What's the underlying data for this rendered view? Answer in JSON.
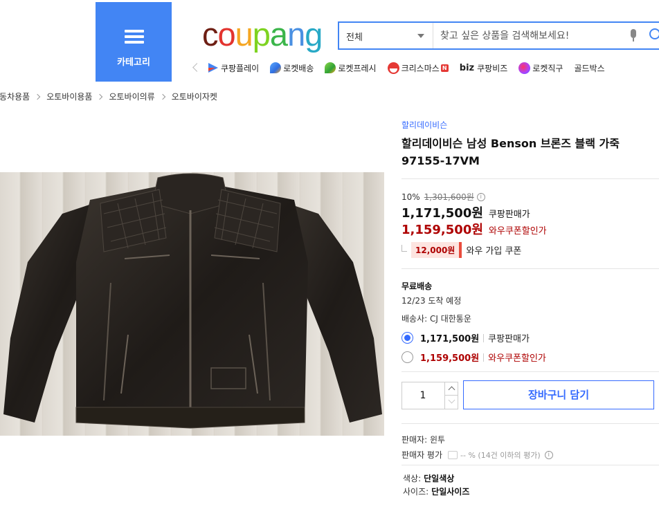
{
  "header": {
    "category_label": "카테고리",
    "logo_text": "coupang",
    "search": {
      "scope": "전체",
      "placeholder": "찾고 싶은 상품을 검색해보세요!"
    },
    "quick_links": [
      {
        "label": "쿠팡플레이",
        "icon": "play-icon"
      },
      {
        "label": "로켓배송",
        "icon": "rocket-icon"
      },
      {
        "label": "로켓프레시",
        "icon": "rocket-fresh-icon"
      },
      {
        "label": "크리스마스",
        "icon": "santa-icon",
        "badge": "N"
      },
      {
        "label": "쿠팡비즈",
        "prefix": "biz"
      },
      {
        "label": "로켓직구",
        "icon": "global-icon"
      },
      {
        "label": "골드박스"
      }
    ]
  },
  "breadcrumb": [
    "자동차용품",
    "오토바이용품",
    "오토바이의류",
    "오토바이자켓"
  ],
  "product": {
    "brand": "할리데이비슨",
    "title_line1": "할리데이비슨 남성 Benson 브론즈 블랙 가죽",
    "title_line2": "97155-17VM",
    "discount_rate": "10%",
    "original_price": "1,301,600원",
    "price": "1,171,500원",
    "price_type": "쿠팡판매가",
    "coupon_price": "1,159,500원",
    "coupon_price_type": "와우쿠폰할인가",
    "wow_coupon_amount": "12,000원",
    "wow_coupon_text": "와우 가입 쿠폰",
    "shipping_title": "무료배송",
    "arrival": "12/23 도착 예정",
    "carrier": "배송사: CJ 대한통운",
    "options": [
      {
        "price": "1,171,500원",
        "label": "쿠팡판매가",
        "selected": true
      },
      {
        "price": "1,159,500원",
        "label": "와우쿠폰할인가",
        "selected": false
      }
    ],
    "quantity": "1",
    "add_to_cart": "장바구니 담기",
    "seller": "판매자: 윈투",
    "seller_rating_label": "판매자 평가",
    "seller_rating_value": "-- % (14건 이하의 평가)",
    "color_label": "색상:",
    "color_value": "단일색상",
    "size_label": "사이즈:",
    "size_value": "단일사이즈"
  },
  "colors": {
    "accent": "#346aff",
    "category_bg": "#4285f4",
    "sale_red": "#ae0000"
  }
}
